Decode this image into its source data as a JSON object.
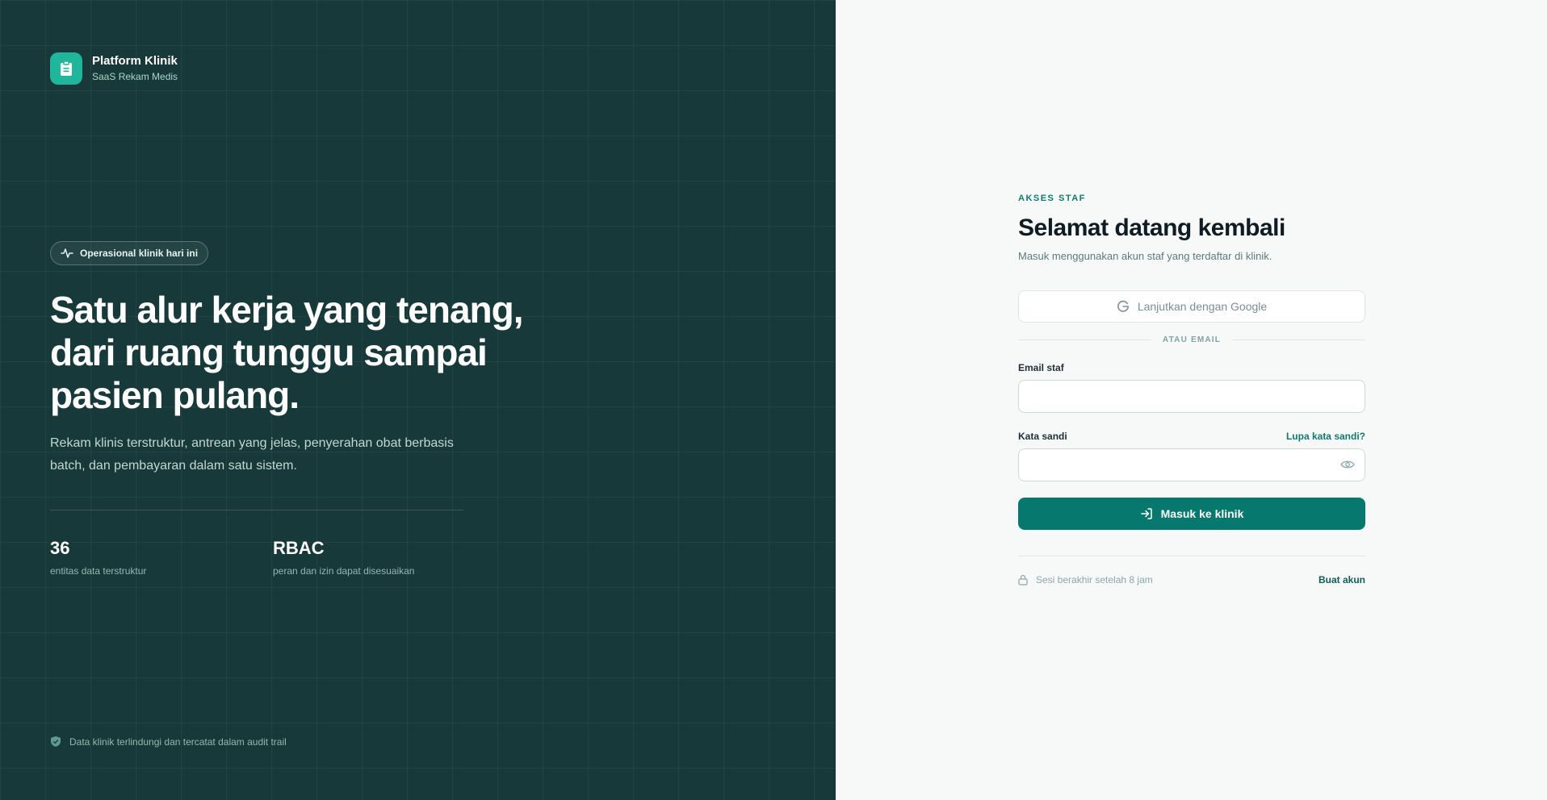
{
  "brand": {
    "name": "Platform Klinik",
    "subtitle": "SaaS Rekam Medis",
    "icon": "clipboard-icon"
  },
  "hero": {
    "badge": "Operasional klinik hari ini",
    "badge_icon": "activity-icon",
    "headline_lines": [
      "Satu alur kerja yang tenang,",
      "dari ruang tunggu sampai",
      "pasien pulang."
    ],
    "lead": "Rekam klinis terstruktur, antrean yang jelas, penyerahan obat berbasis batch, dan pembayaran dalam satu sistem."
  },
  "stats": [
    {
      "value": "36",
      "label": "entitas data terstruktur"
    },
    {
      "value": "RBAC",
      "label": "peran dan izin dapat disesuaikan"
    }
  ],
  "security_note": "Data klinik terlindungi dan tercatat dalam audit trail",
  "login": {
    "eyebrow": "AKSES STAF",
    "title": "Selamat datang kembali",
    "subtitle": "Masuk menggunakan akun staf yang terdaftar di klinik.",
    "google_button": "Lanjutkan dengan Google",
    "divider_text": "ATAU EMAIL",
    "email_label": "Email staf",
    "email_value": "",
    "password_label": "Kata sandi",
    "password_value": "",
    "forgot_link": "Lupa kata sandi?",
    "submit_label": "Masuk ke klinik",
    "session_note": "Sesi berakhir setelah 8 jam",
    "create_account": "Buat akun"
  },
  "colors": {
    "panel": "#18393a",
    "accent": "#07786d",
    "logo": "#1fb69c"
  }
}
